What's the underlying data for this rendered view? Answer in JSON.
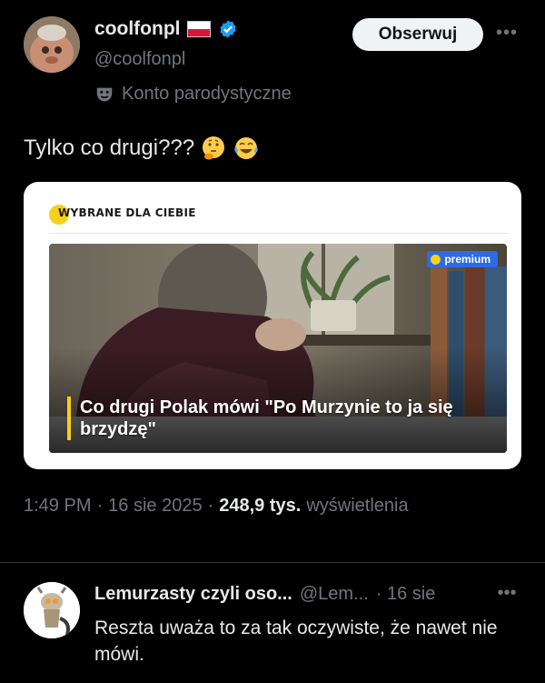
{
  "author": {
    "display_name": "coolfonpl",
    "handle": "@coolfonpl",
    "parody_label": "Konto parodystyczne",
    "follow_label": "Obserwuj",
    "more_label": "•••"
  },
  "tweet": {
    "text": "Tylko co drugi???"
  },
  "card": {
    "label": "WYBRANE DLA CIEBIE",
    "premium_label": "premium",
    "headline": "Co drugi Polak mówi \"Po Murzynie to ja się brzydzę\""
  },
  "meta": {
    "time": "1:49 PM",
    "dot1": "·",
    "date": "16 sie 2025",
    "dot2": "·",
    "views_count": "248,9 tys.",
    "views_label": "wyświetlenia"
  },
  "reply": {
    "display_name": "Lemurzasty czyli oso...",
    "handle": "@Lem...",
    "time": "· 16 sie",
    "more_label": "•••",
    "text": "Reszta uważa to za tak oczywiste, że nawet nie mówi."
  },
  "colors": {
    "background": "#000000",
    "verified": "#1d9bf0",
    "muted": "#71767b",
    "accent_yellow": "#f7d117",
    "premium_blue": "#2d6be4"
  }
}
